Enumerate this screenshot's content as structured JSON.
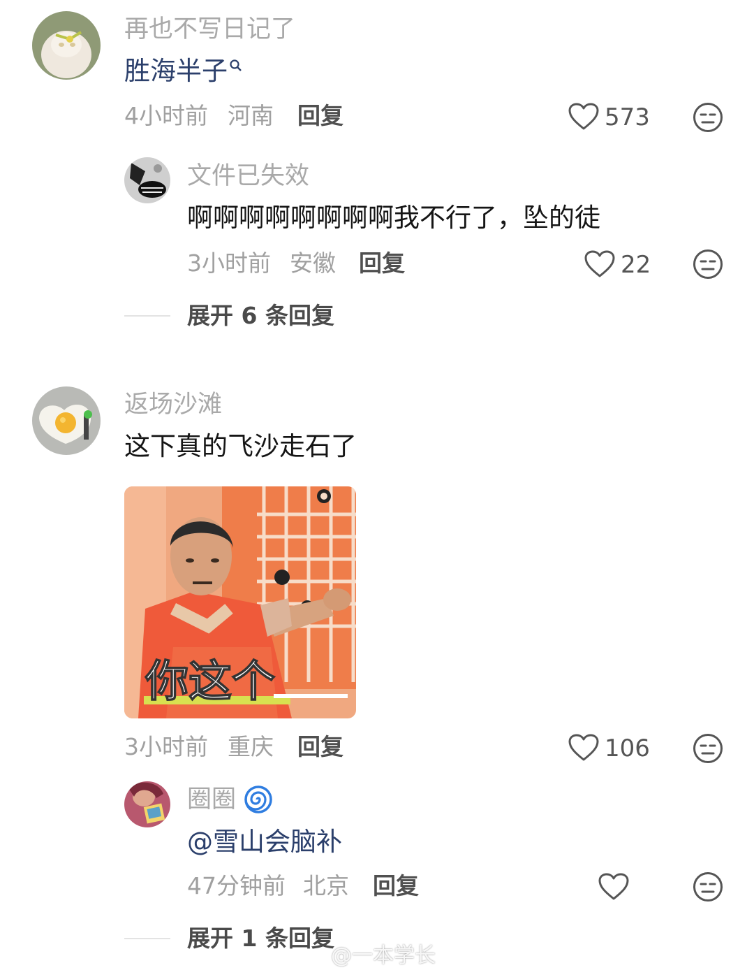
{
  "comments": [
    {
      "name": "再也不写日记了",
      "text": "胜海半子",
      "time": "4小时前",
      "location": "河南",
      "reply_label": "回复",
      "likes": "573",
      "replies": [
        {
          "name": "文件已失效",
          "text": "啊啊啊啊啊啊啊啊我不行了，坠的徒",
          "time": "3小时前",
          "location": "安徽",
          "reply_label": "回复",
          "likes": "22"
        }
      ],
      "expand_label": "展开 6 条回复"
    },
    {
      "name": "返场沙滩",
      "text": "这下真的飞沙走石了",
      "sticker_caption": "你这个",
      "time": "3小时前",
      "location": "重庆",
      "reply_label": "回复",
      "likes": "106",
      "replies": [
        {
          "name": "圈圈",
          "text": "@雪山会脑补",
          "time": "47分钟前",
          "location": "北京",
          "reply_label": "回复",
          "likes": ""
        }
      ],
      "expand_label": "展开 1 条回复"
    }
  ],
  "watermark": "@一本学长",
  "icons": {
    "like": "heart-outline-icon",
    "dislike": "neutral-face-icon",
    "search": "search-icon",
    "badge": "swirl-badge-icon"
  },
  "colors": {
    "link": "#2b3f6b",
    "meta": "#a0a0a0",
    "name": "#a9a9a9"
  }
}
